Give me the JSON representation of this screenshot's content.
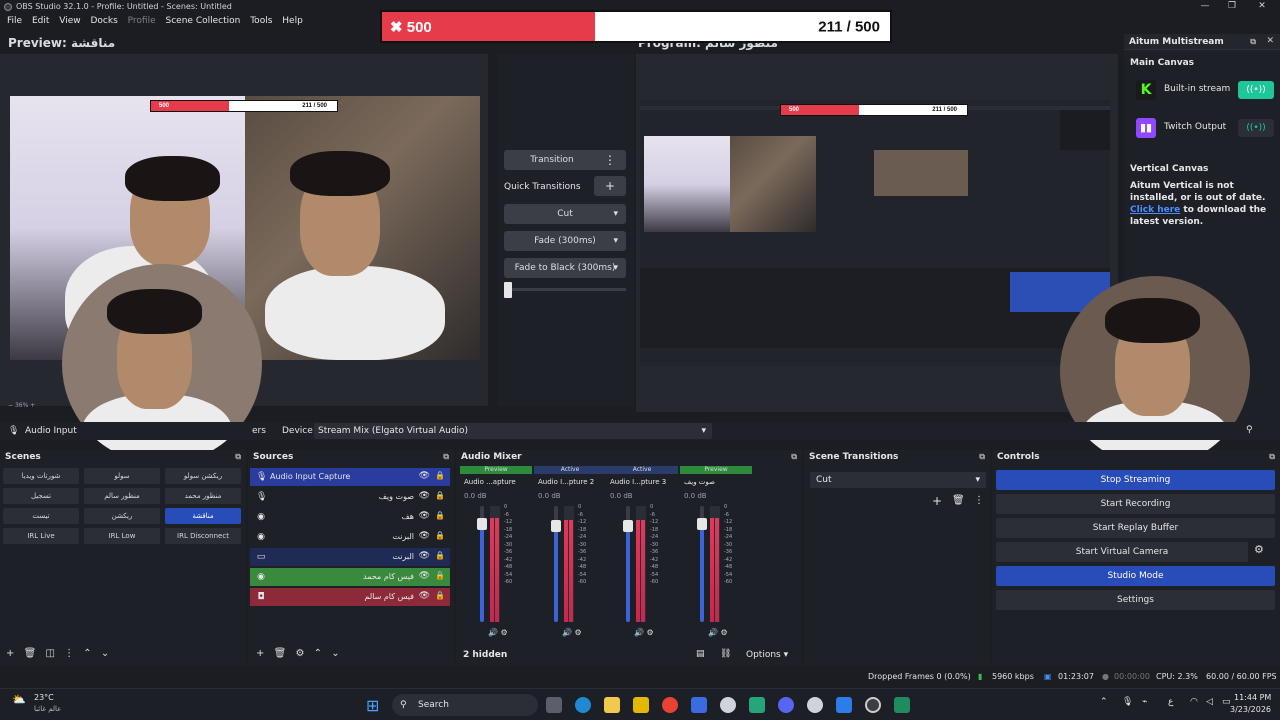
{
  "window": {
    "title": "OBS Studio 32.1.0 - Profile: Untitled - Scenes: Untitled"
  },
  "menu": [
    "File",
    "Edit",
    "View",
    "Docks",
    "Profile",
    "Scene Collection",
    "Tools",
    "Help"
  ],
  "goal": {
    "current_label": "500",
    "count": "211 / 500",
    "progress": 0.42
  },
  "preview": {
    "label": "Preview: مناقشة",
    "zoom": "36%"
  },
  "program": {
    "label": "Program: منظور سالم"
  },
  "transitions_panel": {
    "transition_label": "Transition",
    "quick_label": "Quick Transitions",
    "cut": "Cut",
    "fade": "Fade (300ms)",
    "fade_black": "Fade to Black (300ms)"
  },
  "device_bar": {
    "source": "Audio Input",
    "properties": "ers",
    "device_label": "Device",
    "device_value": "Stream Mix (Elgato Virtual Audio)"
  },
  "altum": {
    "title": "Aitum Multistream",
    "main_canvas": "Main Canvas",
    "outputs": [
      {
        "name": "Built-in stream",
        "color": "#1db954"
      },
      {
        "name": "Twitch Output",
        "color": "#9146ff"
      }
    ],
    "vertical_title": "Vertical Canvas",
    "vertical_text": "Aitum Vertical is not installed, or is out of date.",
    "link": "Click here",
    "link_after": " to download the latest version."
  },
  "scenes": {
    "title": "Scenes",
    "items": [
      "شورتات ويديا",
      "سولو",
      "ريكشن سولو",
      "تسجيل",
      "منظور سالم",
      "منظور محمد",
      "تيست",
      "ريكشن",
      "مناقشة",
      "IRL Live",
      "IRL Low",
      "IRL Disconnect"
    ],
    "selected_index": 8
  },
  "sources": {
    "title": "Sources",
    "items": [
      {
        "name": "Audio Input Capture",
        "icon": "mic-icon",
        "rtl": false
      },
      {
        "name": "صوت ويف",
        "icon": "mic-icon",
        "rtl": true
      },
      {
        "name": "هف",
        "icon": "browser-icon",
        "rtl": true
      },
      {
        "name": "البرنت",
        "icon": "browser-icon",
        "rtl": true
      },
      {
        "name": "البرنت",
        "icon": "folder-icon",
        "rtl": true
      },
      {
        "name": "فيس كام محمد",
        "icon": "browser-icon",
        "rtl": true
      },
      {
        "name": "فيس كام سالم",
        "icon": "camera-icon",
        "rtl": true
      }
    ]
  },
  "mixer": {
    "title": "Audio Mixer",
    "hidden": "2 hidden",
    "options": "Options",
    "channels": [
      {
        "badge": "Preview",
        "badge_color": "#2f8b3c",
        "name": "Audio ...apture",
        "db": "0.0 dB",
        "level": 0.9
      },
      {
        "badge": "Active",
        "badge_color": "#2a3c6b",
        "name": "Audio I...pture 2",
        "db": "0.0 dB",
        "level": 0.88
      },
      {
        "badge": "Active",
        "badge_color": "#2a3c6b",
        "name": "Audio I...pture 3",
        "db": "0.0 dB",
        "level": 0.88
      },
      {
        "badge": "Preview",
        "badge_color": "#2f8b3c",
        "name": "صوت ويف",
        "db": "0.0 dB",
        "level": 0.9
      }
    ],
    "scale": [
      "0",
      "-6",
      "-12",
      "-18",
      "-24",
      "-30",
      "-36",
      "-42",
      "-48",
      "-54",
      "-60"
    ]
  },
  "scene_transitions": {
    "title": "Scene Transitions",
    "value": "Cut"
  },
  "controls": {
    "title": "Controls",
    "buttons": [
      "Stop Streaming",
      "Start Recording",
      "Start Replay Buffer",
      "Start Virtual Camera",
      "Studio Mode",
      "Settings"
    ]
  },
  "status": {
    "dropped": "Dropped Frames 0 (0.0%)",
    "bitrate": "5960 kbps",
    "live_time": "01:23:07",
    "rec_time": "00:00:00",
    "cpu": "CPU: 2.3%",
    "fps": "60.00 / 60.00 FPS"
  },
  "taskbar": {
    "weather_temp": "23°C",
    "weather_place": "عالم غائبا",
    "search": "Search",
    "time": "11:44 PM",
    "date": "3/23/2026"
  }
}
